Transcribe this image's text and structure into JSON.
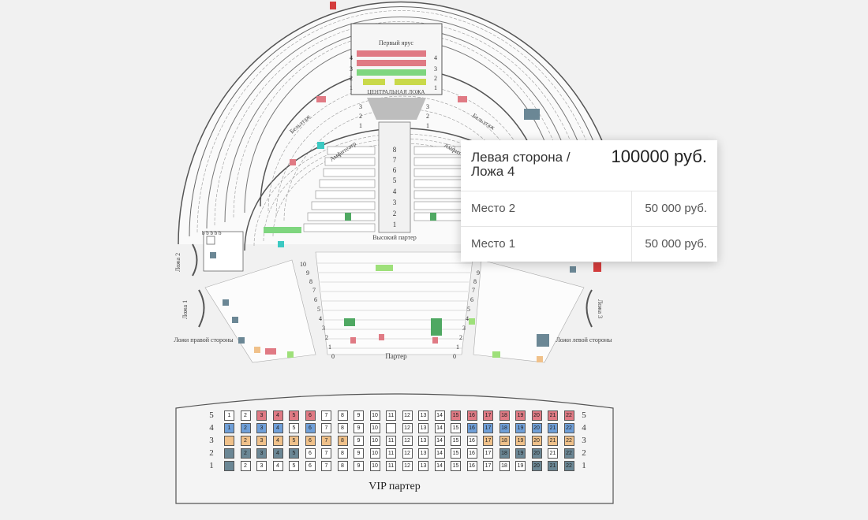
{
  "hall": {
    "labels": {
      "first_tier": "Первый ярус",
      "central_box": "ЦЕНТРАЛЬНАЯ ЛОЖА",
      "beletage_left": "Бельэтаж",
      "beletage_right": "Бельэтаж",
      "amphitheater_left": "Амфитеатр",
      "amphitheater_right": "Амфитеатр",
      "high_parterre": "Высокий партер",
      "parterre": "Партер",
      "box_2": "Ложа 2",
      "box_1": "Ложа 1",
      "box_3": "Ложа 3",
      "boxes_right_side": "Ложи правой стороны",
      "boxes_left_side": "Ложи левой стороны"
    },
    "central_rows": [
      "8",
      "7",
      "6",
      "5",
      "4",
      "3",
      "2",
      "1"
    ],
    "tier_rows": [
      "4",
      "3",
      "2",
      "1"
    ],
    "parterre_rows": [
      "10",
      "9",
      "8",
      "7",
      "6",
      "5",
      "4",
      "3",
      "2",
      "1",
      "0"
    ],
    "beletage_rows": [
      "3",
      "2",
      "1"
    ]
  },
  "vip": {
    "title": "VIP партер",
    "rows": [
      {
        "label": "5",
        "seats": [
          "1",
          "2",
          "3",
          "4",
          "5",
          "6",
          "7",
          "8",
          "9",
          "10",
          "11",
          "12",
          "13",
          "14",
          "15",
          "16",
          "17",
          "18",
          "19",
          "20",
          "21",
          "22"
        ],
        "colors": [
          "white",
          "white",
          "red",
          "red",
          "red",
          "red",
          "white",
          "white",
          "white",
          "white",
          "white",
          "white",
          "white",
          "white",
          "red",
          "red",
          "red",
          "red",
          "red",
          "red",
          "red",
          "red"
        ]
      },
      {
        "label": "4",
        "seats": [
          "1",
          "2",
          "3",
          "4",
          "5",
          "6",
          "7",
          "8",
          "9",
          "10",
          "",
          "12",
          "13",
          "14",
          "15",
          "16",
          "17",
          "18",
          "19",
          "20",
          "21",
          "22"
        ],
        "colors": [
          "blue",
          "blue",
          "blue",
          "blue",
          "white",
          "blue",
          "white",
          "white",
          "white",
          "white",
          "white",
          "white",
          "white",
          "white",
          "white",
          "blue",
          "blue",
          "blue",
          "blue",
          "blue",
          "blue",
          "blue"
        ]
      },
      {
        "label": "3",
        "seats": [
          "",
          "2",
          "3",
          "4",
          "5",
          "6",
          "7",
          "8",
          "9",
          "10",
          "11",
          "12",
          "13",
          "14",
          "15",
          "16",
          "17",
          "18",
          "19",
          "20",
          "21",
          "22"
        ],
        "colors": [
          "orange",
          "orange",
          "orange",
          "orange",
          "orange",
          "orange",
          "orange",
          "orange",
          "white",
          "white",
          "white",
          "white",
          "white",
          "white",
          "white",
          "white",
          "orange",
          "orange",
          "orange",
          "orange",
          "orange",
          "orange"
        ]
      },
      {
        "label": "2",
        "seats": [
          "",
          "2",
          "3",
          "4",
          "5",
          "6",
          "7",
          "8",
          "9",
          "10",
          "11",
          "12",
          "13",
          "14",
          "15",
          "16",
          "17",
          "18",
          "19",
          "20",
          "21",
          "22"
        ],
        "colors": [
          "slate",
          "slate",
          "slate",
          "slate",
          "slate",
          "white",
          "white",
          "white",
          "white",
          "white",
          "white",
          "white",
          "white",
          "white",
          "white",
          "white",
          "white",
          "slate",
          "slate",
          "slate",
          "white",
          "slate"
        ]
      },
      {
        "label": "1",
        "seats": [
          "",
          "2",
          "3",
          "4",
          "5",
          "6",
          "7",
          "8",
          "9",
          "10",
          "11",
          "12",
          "13",
          "14",
          "15",
          "16",
          "17",
          "18",
          "19",
          "20",
          "21",
          "22"
        ],
        "colors": [
          "slate",
          "white",
          "white",
          "white",
          "white",
          "white",
          "white",
          "white",
          "white",
          "white",
          "white",
          "white",
          "white",
          "white",
          "white",
          "white",
          "white",
          "white",
          "white",
          "slate",
          "slate",
          "slate"
        ]
      }
    ]
  },
  "tooltip": {
    "title": "Левая сторона / Ложа 4",
    "total": "100000 руб.",
    "seats": [
      {
        "name": "Место 2",
        "price": "50 000 руб."
      },
      {
        "name": "Место 1",
        "price": "50 000 руб."
      }
    ]
  },
  "colors": {
    "background": "#f1f1f1",
    "seat_red": "#e07a84",
    "seat_green": "#4fa862",
    "seat_light_green": "#9ee07a",
    "seat_yellow": "#c9d94a",
    "seat_teal": "#3cc9c2",
    "seat_slate": "#6b8795",
    "seat_blue": "#6f9fd8",
    "seat_orange": "#f0c18a"
  }
}
